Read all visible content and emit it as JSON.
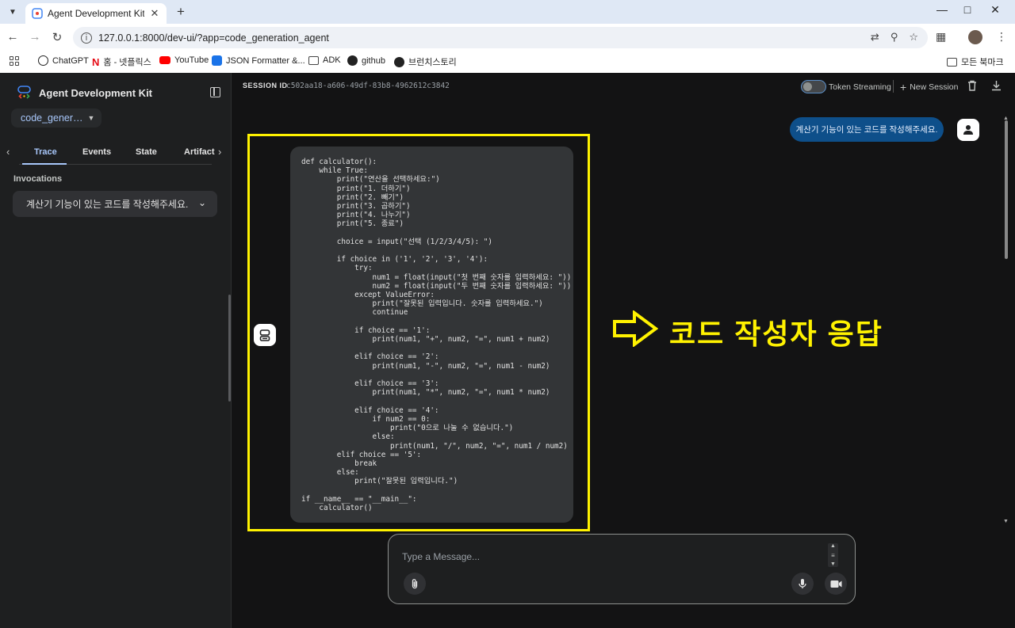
{
  "browser": {
    "tab_title": "Agent Development Kit Dev UI",
    "url": "127.0.0.1:8000/dev-ui/?app=code_generation_agent",
    "bookmarks": [
      {
        "label": "ChatGPT"
      },
      {
        "label": "홈 - 넷플릭스"
      },
      {
        "label": "YouTube"
      },
      {
        "label": "JSON Formatter &..."
      },
      {
        "label": "ADK"
      },
      {
        "label": "github"
      },
      {
        "label": "브런치스토리"
      }
    ],
    "all_bookmarks": "모든 북마크"
  },
  "sidebar": {
    "brand": "Agent Development Kit",
    "app_select": "code_gener…",
    "tabs": [
      "Trace",
      "Events",
      "State",
      "Artifact"
    ],
    "active_tab": "Trace",
    "invocations_label": "Invocations",
    "invocation_item": "계산기 기능이 있는 코드를 작성해주세요."
  },
  "session": {
    "label": "SESSION ID",
    "id": "c502aa18-a606-49df-83b8-4962612c3842",
    "token_streaming": "Token Streaming",
    "new_session": "New Session"
  },
  "chat": {
    "user_message": "계산기 기능이 있는 코드를 작성해주세요.",
    "code": "def calculator():\n    while True:\n        print(\"연산을 선택하세요:\")\n        print(\"1. 더하기\")\n        print(\"2. 빼기\")\n        print(\"3. 곱하기\")\n        print(\"4. 나누기\")\n        print(\"5. 종료\")\n\n        choice = input(\"선택 (1/2/3/4/5): \")\n\n        if choice in ('1', '2', '3', '4'):\n            try:\n                num1 = float(input(\"첫 번째 숫자를 입력하세요: \"))\n                num2 = float(input(\"두 번째 숫자를 입력하세요: \"))\n            except ValueError:\n                print(\"잘못된 입력입니다. 숫자를 입력하세요.\")\n                continue\n\n            if choice == '1':\n                print(num1, \"+\", num2, \"=\", num1 + num2)\n\n            elif choice == '2':\n                print(num1, \"-\", num2, \"=\", num1 - num2)\n\n            elif choice == '3':\n                print(num1, \"*\", num2, \"=\", num1 * num2)\n\n            elif choice == '4':\n                if num2 == 0:\n                    print(\"0으로 나눌 수 없습니다.\")\n                else:\n                    print(num1, \"/\", num2, \"=\", num1 / num2)\n        elif choice == '5':\n            break\n        else:\n            print(\"잘못된 입력입니다.\")\n\nif __name__ == \"__main__\":\n    calculator()",
    "annotation": "코드 작성자 응답"
  },
  "input": {
    "placeholder": "Type a Message..."
  },
  "colors": {
    "annotation_yellow": "#fff200",
    "user_bubble": "#0e4f8a",
    "accent": "#a8c7fa"
  }
}
